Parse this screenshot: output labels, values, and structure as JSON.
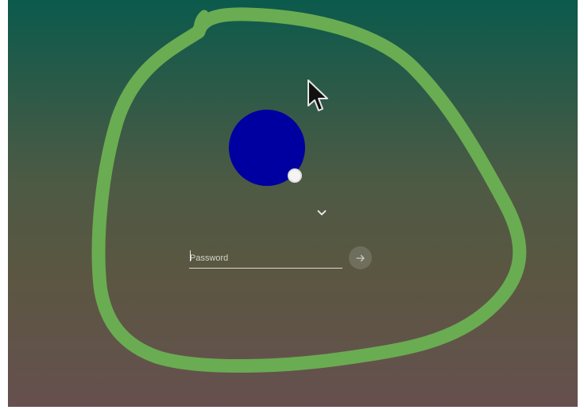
{
  "login": {
    "password_placeholder": "Password",
    "password_value": ""
  },
  "icons": {
    "avatar": "user-avatar",
    "avatar_badge": "status-badge",
    "dropdown": "chevron-down-icon",
    "submit": "arrow-right-icon",
    "cursor": "mouse-pointer-icon"
  },
  "colors": {
    "avatar": "#0000a0",
    "annotation_stroke": "#6aac52",
    "background_top": "#0b5a4c",
    "background_bottom": "#664f4f"
  }
}
